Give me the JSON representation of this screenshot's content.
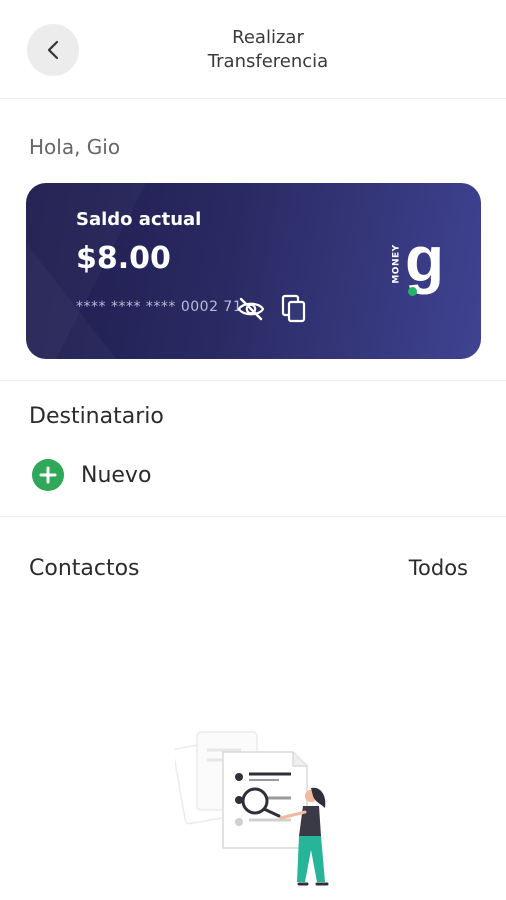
{
  "header": {
    "title_line1": "Realizar",
    "title_line2": "Transferencia",
    "back_icon": "chevron-left-icon"
  },
  "greeting": "Hola, Gio",
  "card": {
    "label": "Saldo actual",
    "balance": "$8.00",
    "masked_number": "**** **** **** 0002 71",
    "eye_icon": "eye-off-icon",
    "copy_icon": "copy-icon",
    "logo_letter": "g",
    "logo_word": "MONEY",
    "colors": {
      "start": "#1f1d4e",
      "end": "#3f4391",
      "dot": "#24b36b"
    }
  },
  "recipient": {
    "title": "Destinatario",
    "new_label": "Nuevo",
    "new_icon": "plus-circle-icon",
    "accent": "#2fa85a"
  },
  "contacts": {
    "title": "Contactos",
    "all_label": "Todos"
  },
  "empty_state": {
    "illustration": "empty-contacts-illustration"
  }
}
